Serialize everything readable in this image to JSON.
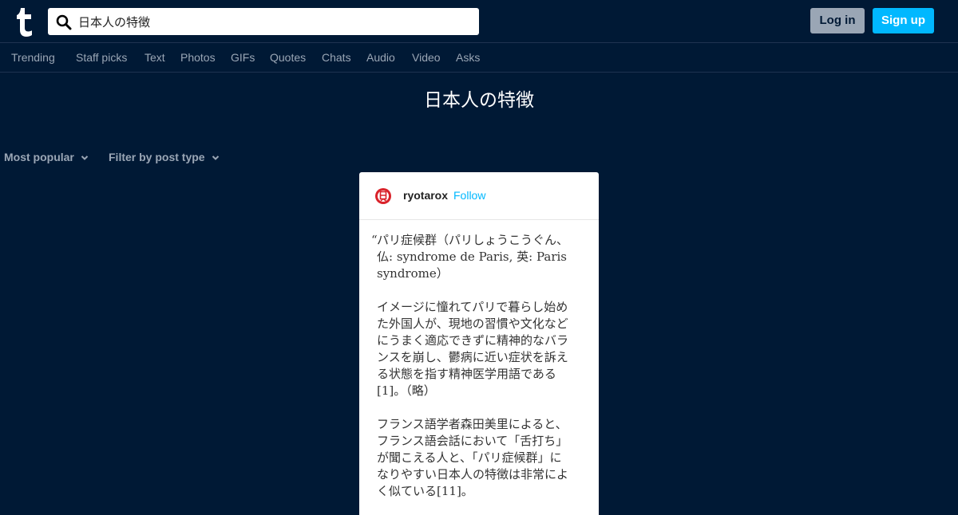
{
  "header": {
    "logo_icon": "tumblr-logo-icon",
    "search": {
      "value": "日本人の特徴",
      "icon": "search-icon"
    },
    "login_label": "Log in",
    "signup_label": "Sign up",
    "colors": {
      "background": "#001935",
      "accent": "#00b8ff",
      "login_bg": "#9aa6b5"
    }
  },
  "nav": {
    "items": [
      {
        "label": "Trending"
      },
      {
        "label": "Staff picks"
      },
      {
        "label": "Text"
      },
      {
        "label": "Photos"
      },
      {
        "label": "GIFs"
      },
      {
        "label": "Quotes"
      },
      {
        "label": "Chats"
      },
      {
        "label": "Audio"
      },
      {
        "label": "Video"
      },
      {
        "label": "Asks"
      }
    ]
  },
  "page": {
    "title": "日本人の特徴"
  },
  "filters": {
    "sort_label": "Most popular",
    "type_label": "Filter by post type",
    "chevron_icon": "chevron-down-icon"
  },
  "post": {
    "avatar_icon": "avatar-icon",
    "username": "ryotarox",
    "follow_label": "Follow",
    "quote_mark": "“",
    "paragraphs": [
      "パリ症候群（パリしょうこうぐん、\n仏: syndrome de Paris, 英: Paris\nsyndrome）",
      "イメージに憧れてパリで暮らし始め\nた外国人が、現地の習慣や文化など\nにうまく適応できずに精神的なバラ\nンスを崩し、鬱病に近い症状を訴え\nる状態を指す精神医学用語である\n[1]。（略）",
      "フランス語学者森田美里によると、\nフランス語会話において「舌打ち」\nが聞こえる人と、「パリ症候群」に\nなりやすい日本人の特徴は非常によ\nく似ている[11]。"
    ]
  }
}
